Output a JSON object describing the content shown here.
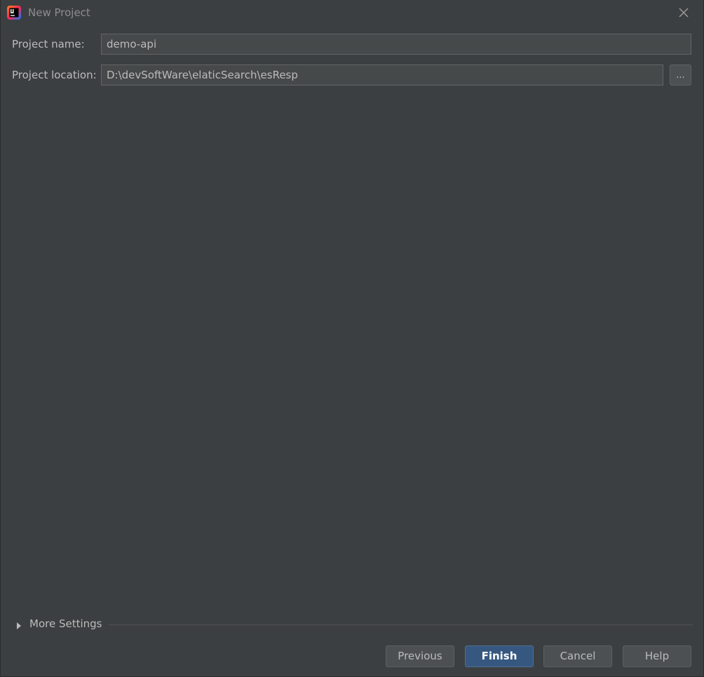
{
  "window": {
    "title": "New Project",
    "app_icon": "intellij-idea-icon",
    "close_icon": "close-icon"
  },
  "form": {
    "project_name_label": "Project name:",
    "project_name_value": "demo-api",
    "project_location_label": "Project location:",
    "project_location_value": "D:\\devSoftWare\\elaticSearch\\esResp",
    "browse_label": "..."
  },
  "more_settings": {
    "label": "More Settings",
    "expanded": false
  },
  "buttons": {
    "previous": "Previous",
    "finish": "Finish",
    "cancel": "Cancel",
    "help": "Help"
  },
  "colors": {
    "background": "#3c3f41",
    "primary_button": "#365880",
    "text": "#bbbbbb"
  }
}
